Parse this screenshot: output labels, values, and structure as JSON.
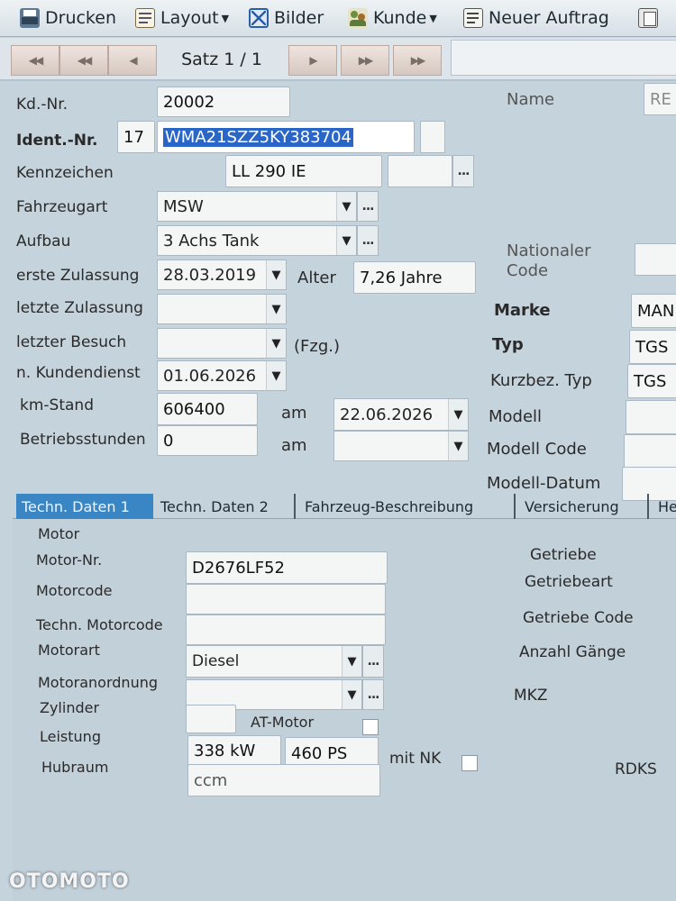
{
  "toolbar": {
    "print": "Drucken",
    "layout": "Layout",
    "images": "Bilder",
    "customer": "Kunde",
    "new_order": "Neuer Auftrag"
  },
  "nav": {
    "first": "◀◀",
    "prev_page": "◀◀",
    "prev": "◀",
    "record": "Satz 1 / 1",
    "next": "▶",
    "next_page": "▶▶",
    "last": "▶▶"
  },
  "vehicle": {
    "kdnr_label": "Kd.-Nr.",
    "kdnr_value": "20002",
    "ident_label": "Ident.-Nr.",
    "ident_count": "17",
    "ident_value": "WMA21SZZ5KY383704",
    "kennzeichen_label": "Kennzeichen",
    "kennzeichen_value": "LL 290 IE",
    "fahrzeugart_label": "Fahrzeugart",
    "fahrzeugart_value": "MSW",
    "aufbau_label": "Aufbau",
    "aufbau_value": "3 Achs Tank",
    "erste_zulassung_label": "erste Zulassung",
    "erste_zulassung_value": "28.03.2019",
    "alter_label": "Alter",
    "alter_value": "7,26 Jahre",
    "letzte_zulassung_label": "letzte Zulassung",
    "letzter_besuch_label": "letzter Besuch",
    "fzg_label": "(Fzg.)",
    "kundendienst_label": "n. Kundendienst",
    "kundendienst_value": "01.06.2026",
    "kmstand_label": "km-Stand",
    "kmstand_value": "606400",
    "am_label": "am",
    "km_date_value": "22.06.2026",
    "betriebsstunden_label": "Betriebsstunden",
    "betriebsstunden_value": "0",
    "am2_label": "am"
  },
  "right": {
    "name_label": "Name",
    "name_value": "RE",
    "nationaler_code_label_1": "Nationaler",
    "nationaler_code_label_2": "Code",
    "marke_label": "Marke",
    "marke_value": "MAN",
    "typ_label": "Typ",
    "typ_value": "TGS",
    "kurzbez_label": "Kurzbez. Typ",
    "kurzbez_value": "TGS",
    "modell_label": "Modell",
    "modell_code_label": "Modell Code",
    "modell_datum_label": "Modell-Datum"
  },
  "tabs": [
    {
      "label": "Techn. Daten 1"
    },
    {
      "label": "Techn. Daten 2"
    },
    {
      "label": "Fahrzeug-Beschreibung"
    },
    {
      "label": "Versicherung"
    },
    {
      "label": "He"
    }
  ],
  "motor": {
    "section_label": "Motor",
    "motor_nr_label": "Motor-Nr.",
    "motor_nr_value": "D2676LF52",
    "motorcode_label": "Motorcode",
    "techn_motorcode_label": "Techn. Motorcode",
    "motorart_label": "Motorart",
    "motorart_value": "Diesel",
    "motoranordnung_label": "Motoranordnung",
    "zylinder_label": "Zylinder",
    "at_motor_label": "AT-Motor",
    "leistung_label": "Leistung",
    "leistung_kw": "338 kW",
    "leistung_ps": "460 PS",
    "mit_nk_label": "mit NK",
    "hubraum_label": "Hubraum",
    "hubraum_unit": "ccm"
  },
  "getriebe": {
    "section_label": "Getriebe",
    "getriebeart_label": "Getriebeart",
    "getriebe_code_label": "Getriebe Code",
    "anzahl_gaenge_label": "Anzahl Gänge",
    "mkz_label": "MKZ",
    "rdks_label": "RDKS"
  },
  "watermark": "OTOMOTO"
}
